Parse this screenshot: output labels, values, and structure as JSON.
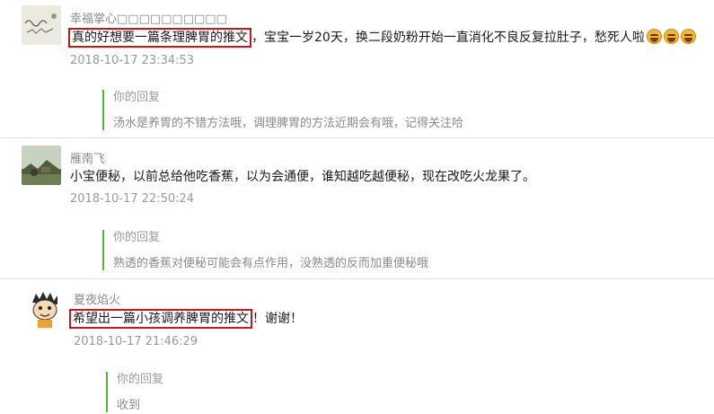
{
  "comments": [
    {
      "username": "幸福掌心□□□□□□□□□□",
      "text_highlight": "真的好想要一篇条理脾胃的推文",
      "text_rest": "，宝宝一岁20天，换二段奶粉开始一直消化不良反复拉肚子，愁死人啦",
      "emoji_icons": [
        "grimace-emoji-icon",
        "grimace-emoji-icon",
        "grimace-emoji-icon"
      ],
      "time": "2018-10-17 23:34:53",
      "reply_label": "你的回复",
      "reply_text": "汤水是养胃的不错方法哦，调理脾胃的方法近期会有哦，记得关注哈"
    },
    {
      "username": "雁南飞",
      "text": "小宝便秘，以前总给他吃香蕉，以为会通便，谁知越吃越便秘，现在改吃火龙果了。",
      "time": "2018-10-17 22:50:24",
      "reply_label": "你的回复",
      "reply_text": "熟透的香蕉对便秘可能会有点作用，没熟透的反而加重便秘哦"
    },
    {
      "username": "夏夜焰火",
      "text_highlight": "希望出一篇小孩调养脾胃的推文",
      "text_rest": "！谢谢！",
      "time": "2018-10-17 21:46:29",
      "reply_label": "你的回复",
      "reply_text": "收到"
    }
  ],
  "colors": {
    "highlight_border": "#c8161d",
    "reply_bar": "#55b33a",
    "divider": "#e2e2e2"
  }
}
